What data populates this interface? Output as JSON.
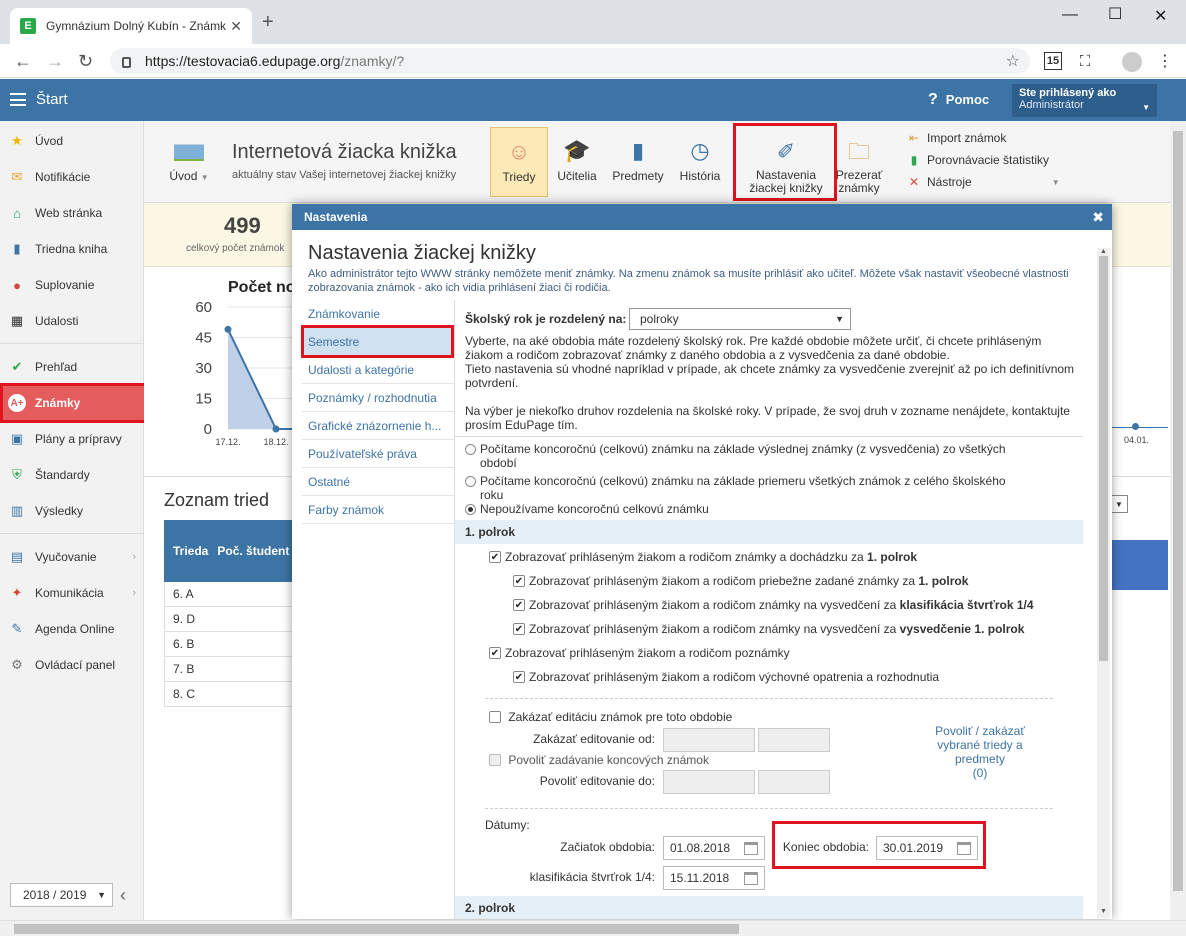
{
  "browser": {
    "tab_title": "Gymnázium Dolný Kubín - Známky",
    "favicon_letter": "E",
    "url_host": "https://testovacia6.edupage.org",
    "url_path": "/znamky/?",
    "ext_badge": "15"
  },
  "header": {
    "start_label": "Štart",
    "help_label": "Pomoc",
    "user_line1": "Ste prihlásený ako",
    "user_line2": "Administrátor"
  },
  "sidebar": {
    "items": [
      {
        "label": "Úvod",
        "icon": "star-icon"
      },
      {
        "label": "Notifikácie",
        "icon": "envelope-icon"
      },
      {
        "label": "Web stránka",
        "icon": "home-icon"
      },
      {
        "label": "Triedna kniha",
        "icon": "book-icon"
      },
      {
        "label": "Suplovanie",
        "icon": "person-icon"
      },
      {
        "label": "Udalosti",
        "icon": "calendar-icon"
      },
      {
        "label": "Prehľad",
        "icon": "check-icon"
      },
      {
        "label": "Známky",
        "icon": "grade-icon"
      },
      {
        "label": "Plány a prípravy",
        "icon": "briefcase-icon"
      },
      {
        "label": "Štandardy",
        "icon": "shield-icon"
      },
      {
        "label": "Výsledky",
        "icon": "bars-icon"
      },
      {
        "label": "Vyučovanie",
        "icon": "books-icon"
      },
      {
        "label": "Komunikácia",
        "icon": "chat-icon"
      },
      {
        "label": "Agenda Online",
        "icon": "pen-icon"
      },
      {
        "label": "Ovládací panel",
        "icon": "gear-icon"
      }
    ],
    "year": "2018 / 2019"
  },
  "toolbar": {
    "uvod_label": "Úvod",
    "title": "Internetová žiacka knižka",
    "subtitle": "aktuálny stav Vašej internetovej žiackej knižky",
    "btn_triedy": "Triedy",
    "btn_ucitelia": "Učitelia",
    "btn_predmety": "Predmety",
    "btn_historia": "História",
    "btn_nastavenia_1": "Nastavenia",
    "btn_nastavenia_2": "žiackej knižky",
    "btn_prezerat_1": "Prezerať",
    "btn_prezerat_2": "známky",
    "import_label": "Import známok",
    "porovnavacie_label": "Porovnávacie štatistiky",
    "nastroje_label": "Nástroje"
  },
  "background": {
    "stat_number": "499",
    "stat_label": "celkový počet známok",
    "chart_title": "Počet no",
    "y_ticks": [
      "60",
      "45",
      "30",
      "15",
      "0"
    ],
    "x_ticks": [
      "17.12.",
      "18.12.",
      "04.01."
    ],
    "classes_title": "Zoznam tried",
    "table_headers": [
      "Trieda",
      "Poč. študent"
    ],
    "classes": [
      "6. A",
      "9. D",
      "6. B",
      "7. B",
      "8. C"
    ]
  },
  "chart_data": {
    "type": "area",
    "x": [
      "17.12.",
      "18.12."
    ],
    "values": [
      49,
      0
    ],
    "title": "Počet no",
    "ylim": [
      0,
      60
    ]
  },
  "dialog": {
    "header": "Nastavenia",
    "title": "Nastavenia žiackej knižky",
    "note": "Ako administrátor tejto WWW stránky nemôžete meniť známky. Na zmenu známok sa musíte prihlásiť ako učiteľ. Môžete však nastaviť všeobecné vlastnosti zobrazovania známok - ako ich vidia prihlásení žiaci či rodičia.",
    "menu": [
      "Známkovanie",
      "Semestre",
      "Udalosti a kategórie",
      "Poznámky / rozhodnutia",
      "Grafické znázornenie h...",
      "Používateľské práva",
      "Ostatné",
      "Farby známok"
    ],
    "school_year_label": "Školský rok je rozdelený na:",
    "school_year_value": "polroky",
    "desc1": "Vyberte, na aké obdobia máte rozdelený školský rok. Pre každé obdobie môžete určiť, či chcete prihláseným žiakom a rodičom zobrazovať známky z daného obdobia a z vysvedčenia za dané obdobie.",
    "desc2": "Tieto nastavenia sú vhodné napríklad v prípade, ak chcete známky za vysvedčenie zverejniť až po ich definitívnom potvrdení.",
    "desc3": "Na výber je niekoľko druhov rozdelenia na školské roky. V prípade, že svoj druh v zozname nenájdete, kontaktujte prosím EduPage tím.",
    "radio1": "Počítame koncoročnú (celkovú) známku na základe výslednej známky (z vysvedčenia) zo všetkých období",
    "radio2": "Počítame koncoročnú (celkovú) známku na základe priemeru všetkých známok z celého školského roku",
    "radio3": "Nepoužívame koncoročnú celkovú známku",
    "section1": "1. polrok",
    "chk1": "Zobrazovať prihláseným žiakom a rodičom známky a dochádzku za",
    "chk1_b": "1. polrok",
    "chk2": "Zobrazovať prihláseným žiakom a rodičom priebežne zadané známky za",
    "chk2_b": "1. polrok",
    "chk3": "Zobrazovať prihláseným žiakom a rodičom známky na vysvedčení za",
    "chk3_b": "klasifikácia štvrťrok 1/4",
    "chk4": "Zobrazovať prihláseným žiakom a rodičom známky na vysvedčení za",
    "chk4_b": "vysvedčenie 1. polrok",
    "chk5": "Zobrazovať prihláseným žiakom a rodičom poznámky",
    "chk6": "Zobrazovať prihláseným žiakom a rodičom výchovné opatrenia a rozhodnutia",
    "chk_lock": "Zakázať editáciu známok pre toto obdobie",
    "lock_from_label": "Zakázať editovanie od:",
    "chk_final": "Povoliť zadávanie koncových známok",
    "final_from_label": "Povoliť editovanie do:",
    "allow_link": "Povoliť / zakázať vybrané triedy a predmety",
    "allow_count": "(0)",
    "dates_label": "Dátumy:",
    "start_label": "Začiatok obdobia:",
    "start_value": "01.08.2018",
    "end_label": "Koniec obdobia:",
    "end_value": "30.01.2019",
    "q_label": "klasifikácia štvrťrok 1/4:",
    "q_value": "15.11.2018",
    "section2": "2. polrok"
  }
}
